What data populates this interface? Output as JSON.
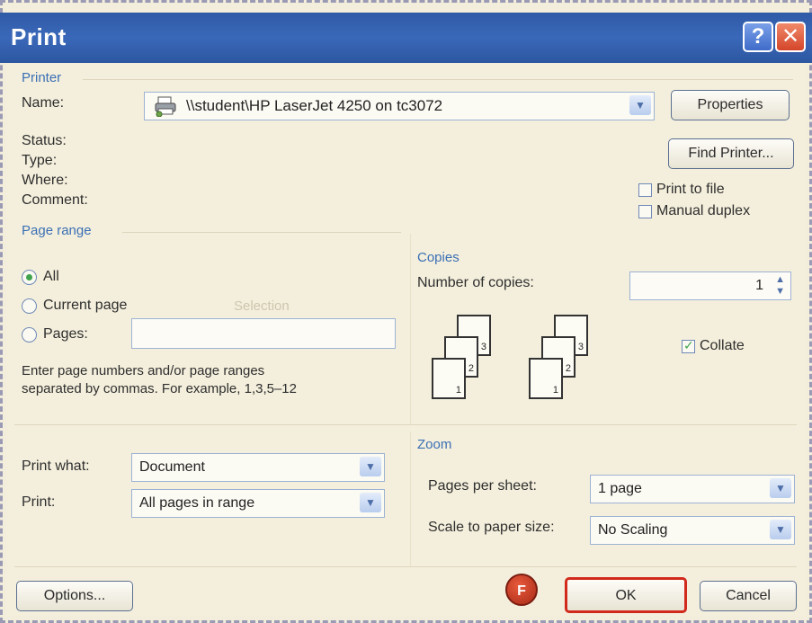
{
  "window": {
    "title": "Print",
    "help_glyph": "?",
    "close_glyph": "✕"
  },
  "printer": {
    "group_label": "Printer",
    "name_label": "Name:",
    "name_value": "\\\\student\\HP LaserJet 4250 on tc3072",
    "status_label": "Status:",
    "type_label": "Type:",
    "where_label": "Where:",
    "comment_label": "Comment:",
    "properties_button": "Properties",
    "find_printer_button": "Find Printer...",
    "print_to_file_label": "Print to file",
    "manual_duplex_label": "Manual duplex",
    "print_to_file_checked": false,
    "manual_duplex_checked": false
  },
  "page_range": {
    "group_label": "Page range",
    "all_label": "All",
    "current_page_label": "Current page",
    "selection_label": "Selection",
    "pages_label": "Pages:",
    "pages_value": "",
    "selected": "All",
    "hint_line1": "Enter page numbers and/or page ranges",
    "hint_line2": "separated by commas.  For example, 1,3,5–12"
  },
  "copies": {
    "group_label": "Copies",
    "number_label": "Number of copies:",
    "number_value": "1",
    "collate_label": "Collate",
    "collate_checked": true,
    "page_icon_labels": [
      "1",
      "2",
      "3"
    ]
  },
  "print_what": {
    "label": "Print what:",
    "value": "Document",
    "print_label": "Print:",
    "print_value": "All pages in range"
  },
  "zoom": {
    "group_label": "Zoom",
    "pages_per_sheet_label": "Pages per sheet:",
    "pages_per_sheet_value": "1 page",
    "scale_label": "Scale to paper size:",
    "scale_value": "No Scaling"
  },
  "footer": {
    "options_button": "Options...",
    "ok_button": "OK",
    "cancel_button": "Cancel",
    "step_marker": "F"
  },
  "colors": {
    "titlebar": "#2f5aa6",
    "group_title": "#3a6fb5",
    "ok_highlight": "#d12a1c",
    "marker": "#c43a22"
  },
  "icons": {
    "printer_icon": "printer-icon",
    "dropdown_icon": "chevron-down-icon",
    "spinner_icon": "spinner-arrows-icon",
    "check_icon": "check-icon"
  }
}
